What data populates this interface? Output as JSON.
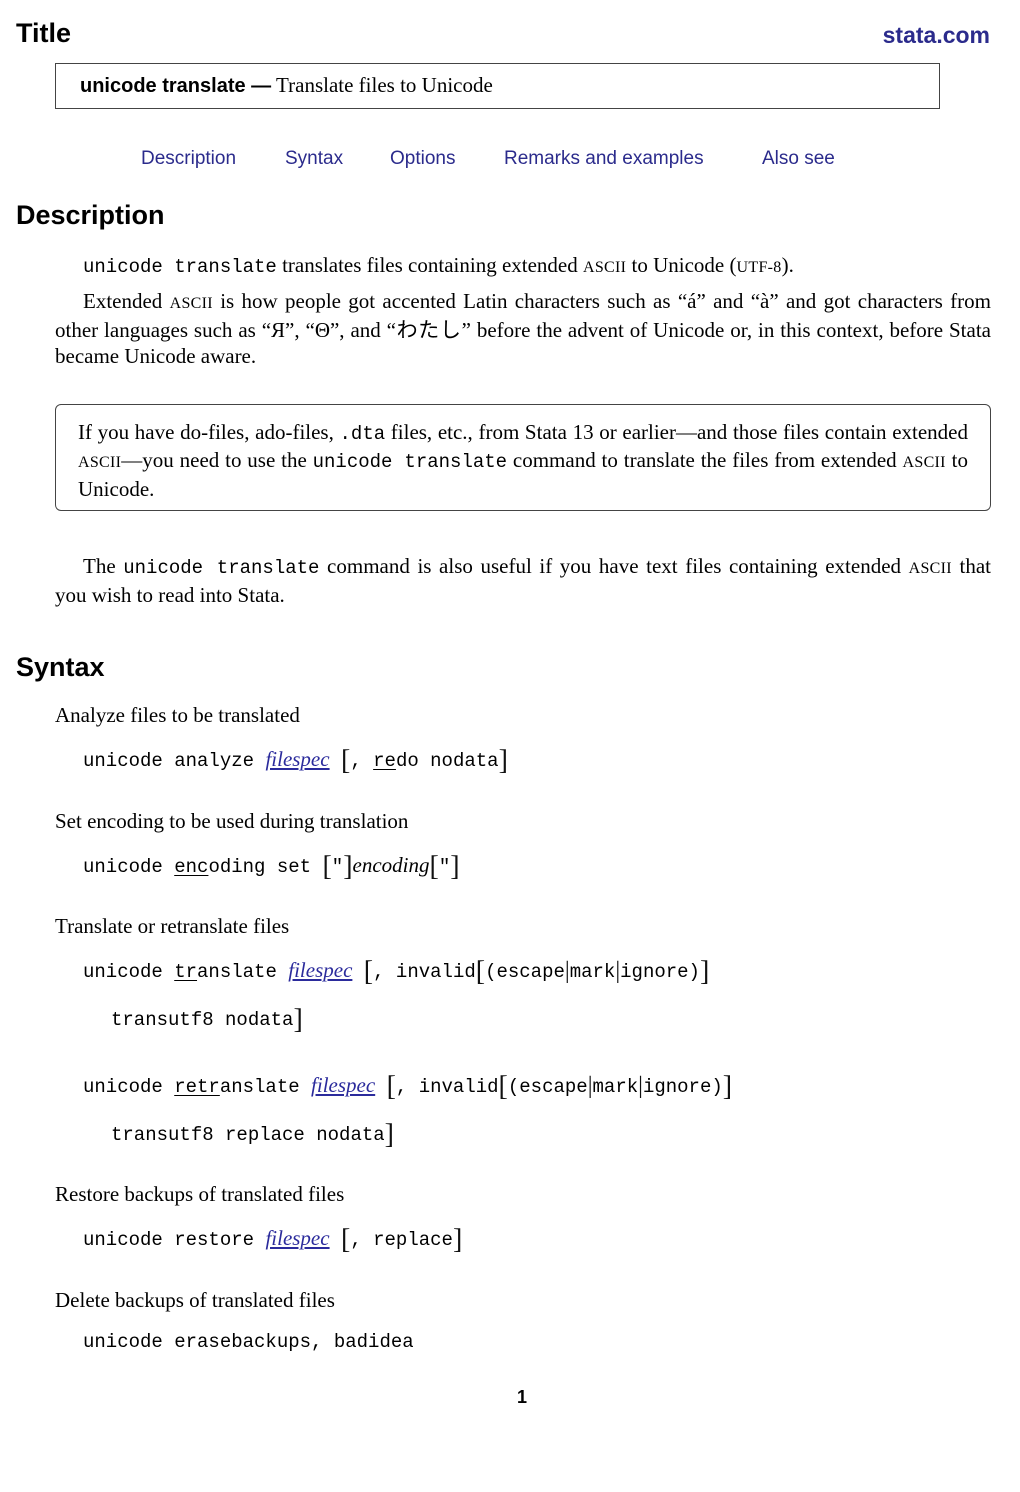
{
  "header": {
    "title": "Title",
    "site_link": "stata.com"
  },
  "title_box": {
    "command": "unicode translate",
    "dash": " —",
    "description": " Translate files to Unicode"
  },
  "nav": {
    "links": [
      "Description",
      "Syntax",
      "Options",
      "Remarks and examples",
      "Also see"
    ]
  },
  "description": {
    "heading": "Description",
    "p1": {
      "cmd": "unicode translate",
      "text1": " translates files containing extended ",
      "ascii": "ASCII",
      "text2": " to Unicode (",
      "utf": "UTF-8",
      "text3": ")."
    },
    "p2": {
      "text1": "Extended ",
      "ascii": "ASCII",
      "text2": " is how people got accented Latin characters such as “á” and “à” and got characters from other languages such as “Я”, “Θ”, and “わたし” before the advent of Unicode or, in this context, before Stata became Unicode aware."
    },
    "note": {
      "text1": "If you have do-files, ado-files, ",
      "dta": ".dta",
      "text2": " files, etc., from Stata 13 or earlier—and those files contain extended ",
      "ascii1": "ASCII",
      "text3": "—you need to use the ",
      "cmd": "unicode translate",
      "text4": " command to translate the files from extended ",
      "ascii2": "ASCII",
      "text5": " to Unicode."
    },
    "p3": {
      "text1": "The ",
      "cmd": "unicode translate",
      "text2": " command is also useful if you have text files containing extended ",
      "ascii": "ASCII",
      "text3": " that you wish to read into Stata."
    }
  },
  "syntax": {
    "heading": "Syntax",
    "analyze": {
      "label": "Analyze files to be translated",
      "cmd": "unicode analyze ",
      "arg": "filespec",
      "opt_pre": ", ",
      "opt_u": "re",
      "opt_rest": "do nodata"
    },
    "encoding": {
      "label": "Set encoding to be used during translation",
      "cmd1": "unicode ",
      "cmd_u": "enc",
      "cmd2": "oding set ",
      "quote": "\"",
      "arg": "encoding"
    },
    "translate": {
      "label": "Translate or retranslate files",
      "cmd1": "unicode ",
      "cmd_u": "tr",
      "cmd2": "anslate ",
      "arg": "filespec",
      "opt1": ", invalid",
      "escape": "(escape",
      "mark": "mark",
      "ignore": "ignore)",
      "line2": "transutf8 nodata"
    },
    "retranslate": {
      "cmd1": "unicode ",
      "cmd_u": "retr",
      "cmd2": "anslate ",
      "arg": "filespec",
      "opt1": ", invalid",
      "escape": "(escape",
      "mark": "mark",
      "ignore": "ignore)",
      "line2": "transutf8 replace nodata"
    },
    "restore": {
      "label": "Restore backups of translated files",
      "cmd": "unicode restore ",
      "arg": "filespec",
      "opt": ", replace"
    },
    "erase": {
      "label": "Delete backups of translated files",
      "cmd": "unicode erasebackups, badidea"
    }
  },
  "footer": {
    "page_number": "1"
  }
}
